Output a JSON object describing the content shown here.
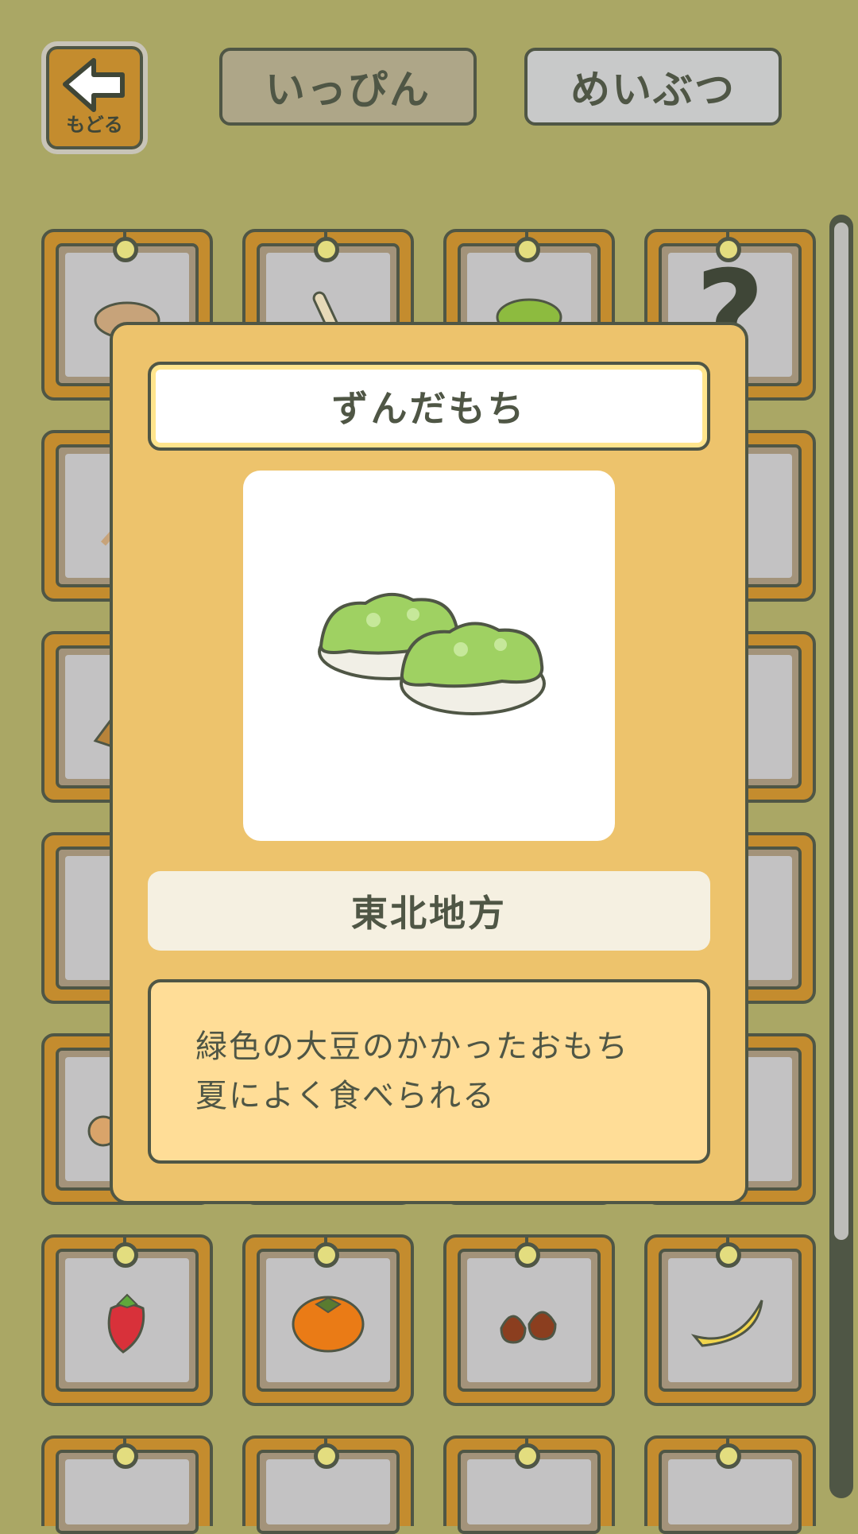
{
  "header": {
    "back_label": "もどる",
    "tabs": [
      {
        "label": "いっぴん",
        "active": true
      },
      {
        "label": "めいぶつ",
        "active": false
      }
    ]
  },
  "grid": {
    "cards": [
      {
        "icon": "rice-cracker-icon"
      },
      {
        "icon": "stick-snack-icon"
      },
      {
        "icon": "zunda-mochi-icon"
      },
      {
        "icon": "unknown-question-icon",
        "text": "?"
      },
      {
        "icon": "skewer-icon"
      },
      {
        "icon": "dango-icon"
      },
      {
        "icon": "tray-icon"
      },
      {
        "icon": "unknown-question-icon"
      },
      {
        "icon": "unknown-icon"
      },
      {
        "icon": "cabbage-icon"
      },
      {
        "icon": "onion-icon"
      },
      {
        "icon": "chili-pepper-icon"
      },
      {
        "icon": "strawberry-icon"
      },
      {
        "icon": "persimmon-icon"
      },
      {
        "icon": "chestnut-icon"
      },
      {
        "icon": "banana-icon"
      }
    ]
  },
  "modal": {
    "name": "ずんだもち",
    "image_icon": "zunda-mochi-icon",
    "region": "東北地方",
    "description_line1": "緑色の大豆のかかったおもち",
    "description_line2": "夏によく食べられる"
  },
  "colors": {
    "background": "#aaa765",
    "modal": "#edc36c",
    "card_frame": "#c48c2e",
    "outline": "#4f5645"
  }
}
